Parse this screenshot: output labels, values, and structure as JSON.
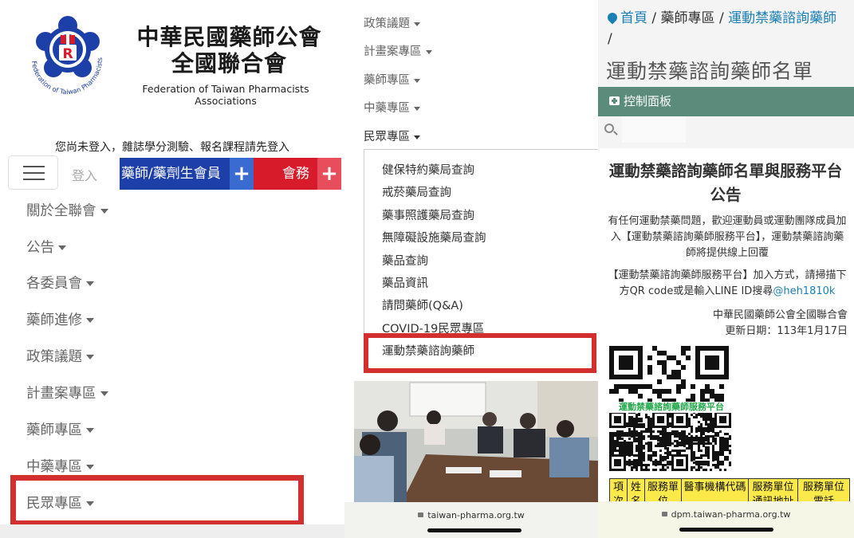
{
  "panel1": {
    "org_name_zh_line1": "中華民國藥師公會",
    "org_name_zh_line2": "全國聯合會",
    "org_name_en": "Federation of Taiwan Pharmacists Associations",
    "logo_ring_text": "Federation of Taiwan Pharmacists Associations",
    "logo_letter": "R",
    "login_notice": "您尚未登入，雜誌學分測驗、報名課程請先登入",
    "login_label": "登入",
    "member_label": "藥師/藥劑生會員",
    "duty_label": "會務",
    "plus_label": "+",
    "menu": [
      "關於全聯會",
      "公告",
      "各委員會",
      "藥師進修",
      "政策議題",
      "計畫案專區",
      "藥師專區",
      "中藥專區",
      "民眾專區"
    ]
  },
  "panel2": {
    "menu": [
      "政策議題",
      "計畫案專區",
      "藥師專區",
      "中藥專區",
      "民眾專區"
    ],
    "dropdown": [
      "健保特約藥局查詢",
      "戒菸藥局查詢",
      "藥事照護藥局查詢",
      "無障礙設施藥局查詢",
      "藥品查詢",
      "藥品資訊",
      "請問藥師(Q&A)",
      "COVID-19民眾專區",
      "運動禁藥諮詢藥師"
    ],
    "url": "taiwan-pharma.org.tw"
  },
  "panel3": {
    "breadcrumb": {
      "home": "首頁",
      "sep": " / ",
      "section": "藥師專區",
      "current": "運動禁藥諮詢藥師",
      "trailing": "/"
    },
    "page_title": "運動禁藥諮詢藥師名單",
    "control_panel": "控制面板",
    "card_title": "運動禁藥諮詢藥師名單與服務平台公告",
    "para1": "有任何運動禁藥問題，歡迎運動員或運動團隊成員加入【運動禁藥諮詢藥師服務平台】，運動禁藥諮詢藥師將提供線上回覆",
    "para2_prefix": "【運動禁藥諮詢藥師服務平台】加入方式，請掃描下方QR code或是輸入LINE ID搜尋",
    "line_id": "@heh1810k",
    "publisher": "中華民國藥師公會全國聯合會",
    "update_date": "更新日期：113年1月17日",
    "qr_caption": "運動禁藥諮詢藥師服務平台",
    "table_headers": [
      "項次",
      "姓名",
      "服務單位",
      "醫事機構代碼",
      "服務單位通訊地址",
      "服務單位電話"
    ],
    "url": "dpm.taiwan-pharma.org.tw"
  },
  "colors": {
    "highlight": "#d32f2f",
    "member_blue": "#1d3fa8",
    "duty_red": "#d81b2a",
    "panel_green": "#5b8b7a",
    "link_blue": "#1a7fb5",
    "qr_green": "#22a84a",
    "table_yellow": "#fbe94a"
  }
}
